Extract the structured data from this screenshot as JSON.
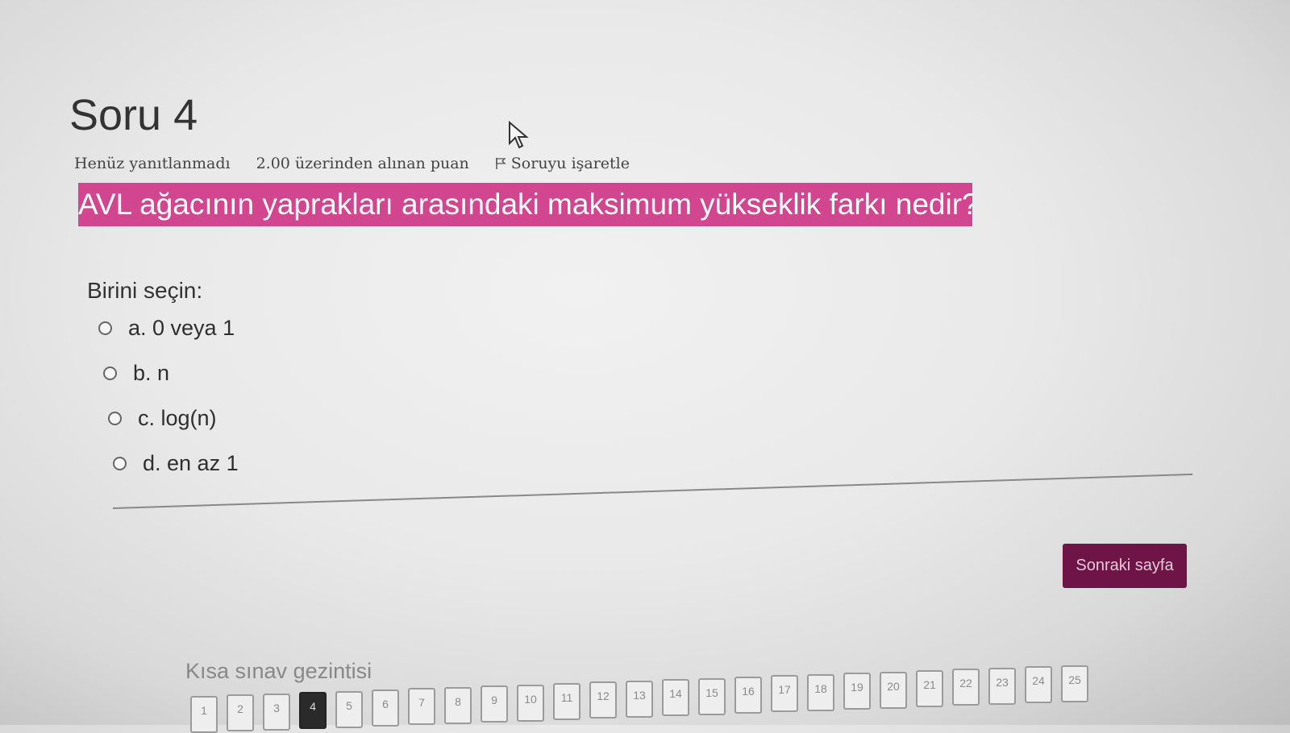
{
  "question": {
    "title": "Soru 4",
    "status": "Henüz yanıtlanmadı",
    "points": "2.00 üzerinden alınan puan",
    "flag_label": "Soruyu işaretle",
    "text": "AVL ağacının yaprakları arasındaki maksimum yükseklik farkı nedir?"
  },
  "answer": {
    "prompt": "Birini seçin:",
    "options": [
      {
        "label": "a. 0 veya 1"
      },
      {
        "label": "b. n"
      },
      {
        "label": "c. log(n)"
      },
      {
        "label": "d. en az 1"
      }
    ]
  },
  "next_button": "Sonraki sayfa",
  "navigation": {
    "title": "Kısa sınav gezintisi",
    "current": "4",
    "items": [
      "1",
      "2",
      "3",
      "4",
      "5",
      "6",
      "7",
      "8",
      "9",
      "10",
      "11",
      "12",
      "13",
      "14",
      "15",
      "16",
      "17",
      "18",
      "19",
      "20",
      "21",
      "22",
      "23",
      "24",
      "25"
    ]
  },
  "colors": {
    "question_highlight": "#d1468f",
    "next_button": "#6e1446"
  }
}
